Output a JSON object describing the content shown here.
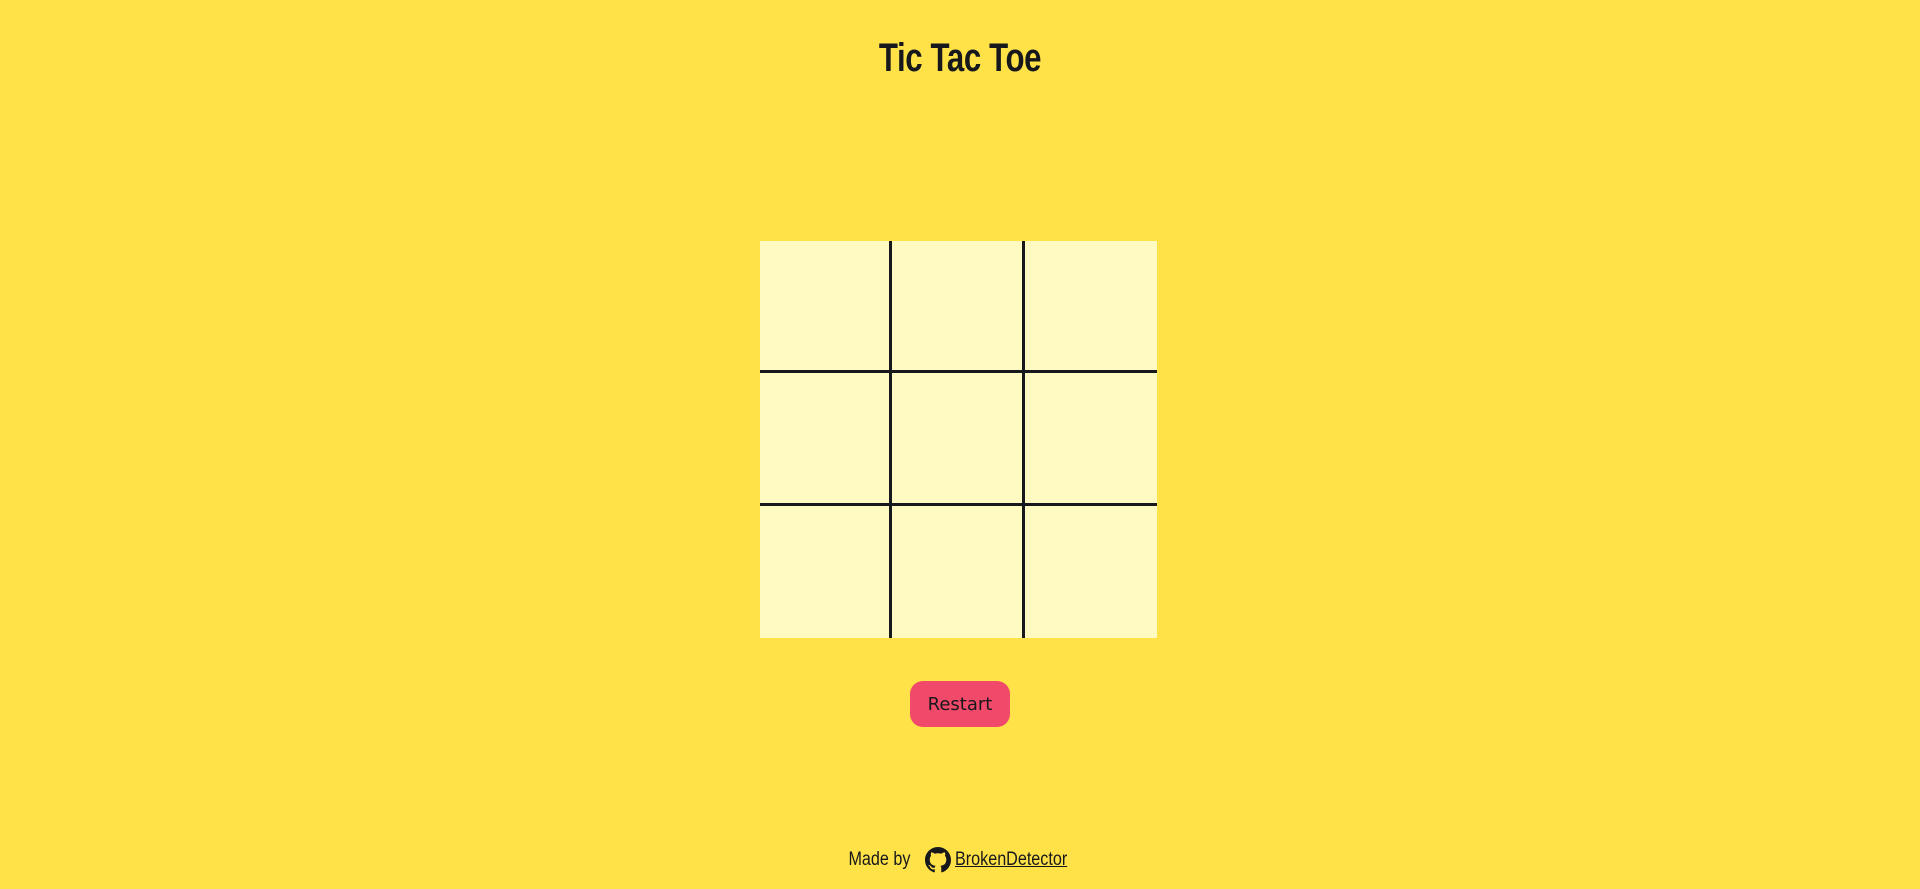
{
  "header": {
    "title": "Tic Tac Toe"
  },
  "board": {
    "cells": [
      "",
      "",
      "",
      "",
      "",
      "",
      "",
      "",
      ""
    ]
  },
  "controls": {
    "restart_label": "Restart"
  },
  "footer": {
    "made_by_label": "Made by",
    "author_link_label": "BrokenDetector",
    "icon": "github-icon"
  },
  "colors": {
    "background": "#FFE248",
    "board_cell": "#FFF9C2",
    "grid_lines": "#17181C",
    "restart_button": "#F1496A"
  }
}
